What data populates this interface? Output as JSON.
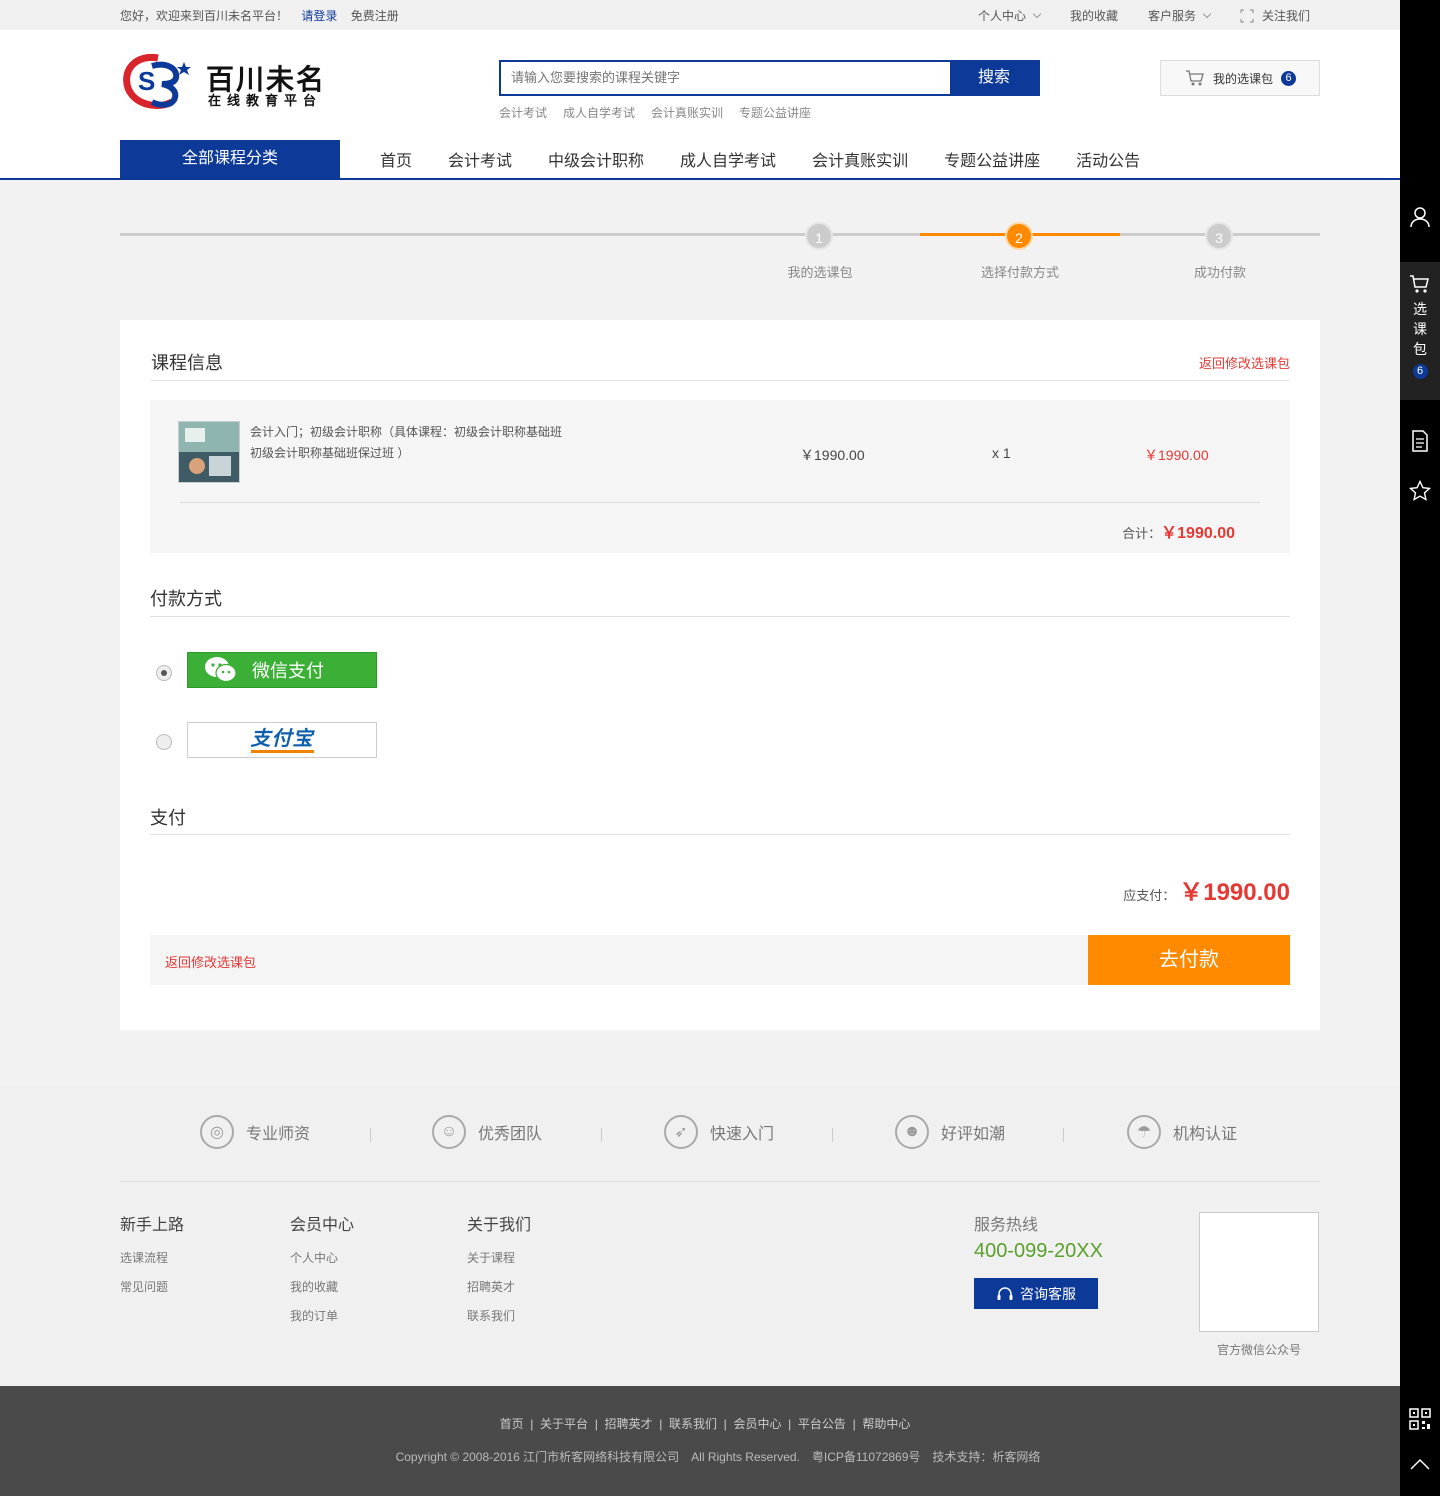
{
  "topbar": {
    "welcome": "您好，欢迎来到百川未名平台！",
    "login": "请登录",
    "register": "免费注册",
    "personal": "个人中心",
    "favorites": "我的收藏",
    "service": "客户服务",
    "follow": "关注我们"
  },
  "header": {
    "logo_name": "百川未名",
    "logo_sub": "在线教育平台",
    "search_placeholder": "请输入您要搜索的课程关键字",
    "search_btn": "搜索",
    "hot_keywords": [
      "会计考试",
      "成人自学考试",
      "会计真账实训",
      "专题公益讲座"
    ],
    "cart_label": "我的选课包",
    "cart_count": "6"
  },
  "nav": {
    "all": "全部课程分类",
    "links": [
      "首页",
      "会计考试",
      "中级会计职称",
      "成人自学考试",
      "会计真账实训",
      "专题公益讲座",
      "活动公告"
    ]
  },
  "steps": [
    {
      "num": "1",
      "label": "我的选课包"
    },
    {
      "num": "2",
      "label": "选择付款方式"
    },
    {
      "num": "3",
      "label": "成功付款"
    }
  ],
  "course": {
    "title": "课程信息",
    "back": "返回修改选课包",
    "name_line1": "会计入门；初级会计职称（具体课程：初级会计职称基础班",
    "name_line2": "初级会计职称基础班保过班 ）",
    "price": "￥1990.00",
    "qty": "x 1",
    "subtotal": "￥1990.00",
    "total_label": "合计：",
    "total": "￥1990.00"
  },
  "payment": {
    "title": "付款方式",
    "wechat": "微信支付",
    "alipay": "支付宝"
  },
  "pay": {
    "title": "支付",
    "due_label": "应支付：",
    "due": "￥1990.00",
    "back": "返回修改选课包",
    "button": "去付款"
  },
  "features": [
    "专业师资",
    "优秀团队",
    "快速入门",
    "好评如潮",
    "机构认证"
  ],
  "footer": {
    "cols": [
      {
        "title": "新手上路",
        "items": [
          "选课流程",
          "常见问题"
        ]
      },
      {
        "title": "会员中心",
        "items": [
          "个人中心",
          "我的收藏",
          "我的订单"
        ]
      },
      {
        "title": "关于我们",
        "items": [
          "关于课程",
          "招聘英才",
          "联系我们"
        ]
      }
    ],
    "hotline_label": "服务热线",
    "hotline": "400-099-20XX",
    "consult": "咨询客服",
    "qr_label": "官方微信公众号"
  },
  "bottom": {
    "links": [
      "首页",
      "关于平台",
      "招聘英才",
      "联系我们",
      "会员中心",
      "平台公告",
      "帮助中心"
    ],
    "copyright": "Copyright © 2008-2016 江门市析客网络科技有限公司　All Rights Reserved.　粤ICP备11072869号　技术支持：析客网络"
  },
  "side": {
    "cart_chars": [
      "选",
      "课",
      "包"
    ],
    "cart_count": "6"
  },
  "colors": {
    "primary": "#0d3a99",
    "accent": "#ff8a00",
    "price": "#e53935",
    "wechat": "#3caf36"
  }
}
